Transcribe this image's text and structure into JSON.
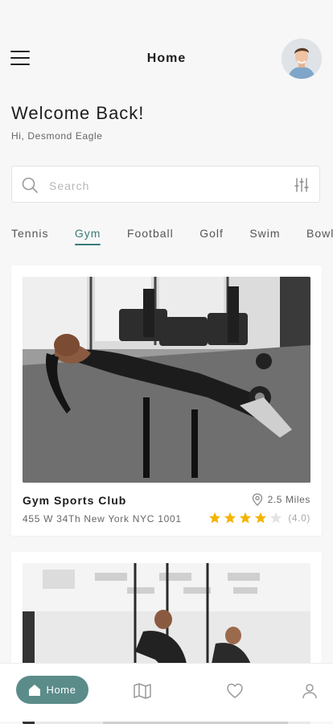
{
  "header": {
    "title": "Home"
  },
  "welcome": {
    "title": "Welcome Back!",
    "greeting": "Hi, Desmond Eagle"
  },
  "search": {
    "placeholder": "Search"
  },
  "tabs": [
    {
      "label": "Tennis",
      "active": false
    },
    {
      "label": "Gym",
      "active": true
    },
    {
      "label": "Football",
      "active": false
    },
    {
      "label": "Golf",
      "active": false
    },
    {
      "label": "Swim",
      "active": false
    },
    {
      "label": "Bowling",
      "active": false
    }
  ],
  "cards": [
    {
      "name": "Gym Sports Club",
      "address": "455 W 34Th New York NYC 1001",
      "distance": "2.5 Miles",
      "rating": 4,
      "rating_text": "(4.0)"
    }
  ],
  "bottom_nav": {
    "home_label": "Home"
  },
  "colors": {
    "accent": "#3b7a78",
    "nav_pill": "#5b8c8a",
    "star": "#f5b301",
    "star_empty": "#e3e3e3"
  },
  "icons": [
    "menu-icon",
    "search-icon",
    "filter-icon",
    "location-pin-icon",
    "star-icon",
    "home-icon",
    "map-icon",
    "heart-icon",
    "profile-icon"
  ]
}
